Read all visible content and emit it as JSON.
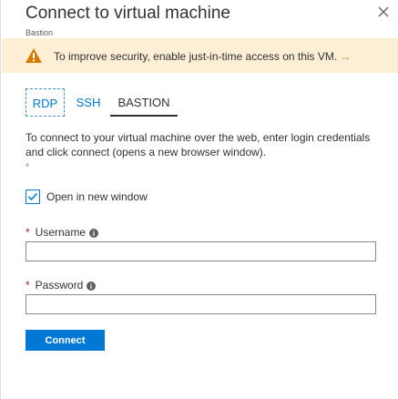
{
  "header": {
    "title": "Connect to virtual machine",
    "subtitle": "Bastion",
    "close_icon": "close-icon"
  },
  "banner": {
    "icon": "warning-icon",
    "message": "To improve security, enable just-in-time access on this VM.",
    "arrow": "→",
    "colors": {
      "background": "#fdefd6",
      "icon": "#d87900"
    }
  },
  "tabs": [
    {
      "label": "RDP",
      "active": false
    },
    {
      "label": "SSH",
      "active": false
    },
    {
      "label": "BASTION",
      "active": true
    }
  ],
  "main": {
    "description": "To connect to your virtual machine over the web, enter login credentials and click connect (opens a new browser window).",
    "marker": "°",
    "open_in_new_window": {
      "label": "Open in new window",
      "checked": true
    },
    "username": {
      "required_mark": "*",
      "label": "Username",
      "value": ""
    },
    "password": {
      "required_mark": "*",
      "label": "Password",
      "value": ""
    },
    "connect_label": "Connect"
  },
  "colors": {
    "accent": "#0078d4",
    "required": "#a4262c"
  }
}
